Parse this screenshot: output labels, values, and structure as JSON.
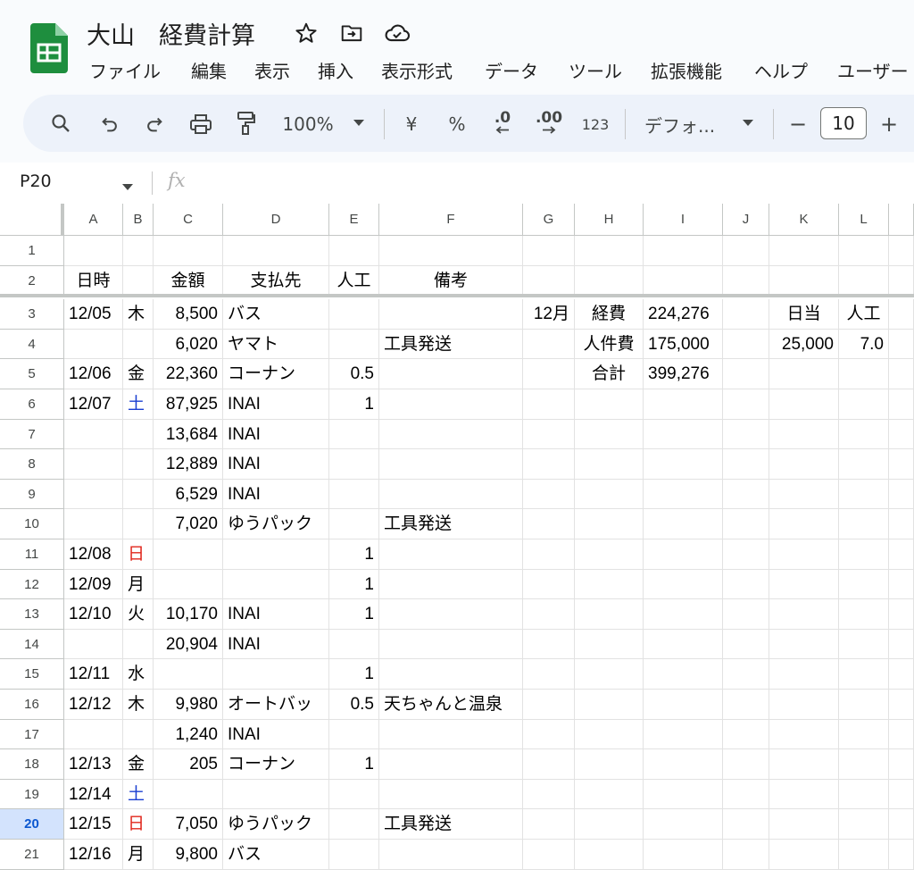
{
  "title": {
    "text": "大山　経費計算",
    "icons": [
      "star-icon",
      "move-folder-icon",
      "cloud-status-icon"
    ]
  },
  "menu": [
    "ファイル",
    "編集",
    "表示",
    "挿入",
    "表示形式",
    "データ",
    "ツール",
    "拡張機能",
    "ヘルプ",
    "ユーザー"
  ],
  "toolbar": {
    "zoom": "100%",
    "currency": "¥",
    "percent": "%",
    "dec_decrease": ".0",
    "dec_increase": ".00",
    "number_format": "123",
    "font": "デフォ...",
    "font_size_minus": "−",
    "font_size": "10",
    "font_size_plus": "+"
  },
  "formula_bar": {
    "name_box": "P20",
    "fx": "fx",
    "value": ""
  },
  "selected_row": "20",
  "columns": [
    "A",
    "B",
    "C",
    "D",
    "E",
    "F",
    "G",
    "H",
    "I",
    "J",
    "K",
    "L"
  ],
  "rows": [
    {
      "num": "1",
      "A": "",
      "B": "",
      "C": "",
      "D": "",
      "E": "",
      "F": "",
      "G": "",
      "H": "",
      "I": "",
      "J": "",
      "K": "",
      "L": ""
    },
    {
      "num": "2",
      "A": "日時",
      "B": "",
      "C": "金額",
      "D": "支払先",
      "E": "人工",
      "F": "備考",
      "G": "",
      "H": "",
      "I": "",
      "J": "",
      "K": "",
      "L": ""
    },
    {
      "num": "3",
      "A": "12/05",
      "B": "木",
      "C": "8,500",
      "D": "バス",
      "E": "",
      "F": "",
      "G": "12月",
      "H": "経費",
      "I": "224,276",
      "J": "",
      "K": "日当",
      "L": "人工"
    },
    {
      "num": "4",
      "A": "",
      "B": "",
      "C": "6,020",
      "D": "ヤマト",
      "E": "",
      "F": "工具発送",
      "G": "",
      "H": "人件費",
      "I": "175,000",
      "J": "",
      "K": "25,000",
      "L": "7.0"
    },
    {
      "num": "5",
      "A": "12/06",
      "B": "金",
      "C": "22,360",
      "D": "コーナン",
      "E": "0.5",
      "F": "",
      "G": "",
      "H": "合計",
      "I": "399,276",
      "J": "",
      "K": "",
      "L": ""
    },
    {
      "num": "6",
      "A": "12/07",
      "B": "土",
      "C": "87,925",
      "D": "INAI",
      "E": "1",
      "F": "",
      "G": "",
      "H": "",
      "I": "",
      "J": "",
      "K": "",
      "L": ""
    },
    {
      "num": "7",
      "A": "",
      "B": "",
      "C": "13,684",
      "D": "INAI",
      "E": "",
      "F": "",
      "G": "",
      "H": "",
      "I": "",
      "J": "",
      "K": "",
      "L": ""
    },
    {
      "num": "8",
      "A": "",
      "B": "",
      "C": "12,889",
      "D": "INAI",
      "E": "",
      "F": "",
      "G": "",
      "H": "",
      "I": "",
      "J": "",
      "K": "",
      "L": ""
    },
    {
      "num": "9",
      "A": "",
      "B": "",
      "C": "6,529",
      "D": "INAI",
      "E": "",
      "F": "",
      "G": "",
      "H": "",
      "I": "",
      "J": "",
      "K": "",
      "L": ""
    },
    {
      "num": "10",
      "A": "",
      "B": "",
      "C": "7,020",
      "D": "ゆうパック",
      "E": "",
      "F": "工具発送",
      "G": "",
      "H": "",
      "I": "",
      "J": "",
      "K": "",
      "L": ""
    },
    {
      "num": "11",
      "A": "12/08",
      "B": "日",
      "C": "",
      "D": "",
      "E": "1",
      "F": "",
      "G": "",
      "H": "",
      "I": "",
      "J": "",
      "K": "",
      "L": ""
    },
    {
      "num": "12",
      "A": "12/09",
      "B": "月",
      "C": "",
      "D": "",
      "E": "1",
      "F": "",
      "G": "",
      "H": "",
      "I": "",
      "J": "",
      "K": "",
      "L": ""
    },
    {
      "num": "13",
      "A": "12/10",
      "B": "火",
      "C": "10,170",
      "D": "INAI",
      "E": "1",
      "F": "",
      "G": "",
      "H": "",
      "I": "",
      "J": "",
      "K": "",
      "L": ""
    },
    {
      "num": "14",
      "A": "",
      "B": "",
      "C": "20,904",
      "D": "INAI",
      "E": "",
      "F": "",
      "G": "",
      "H": "",
      "I": "",
      "J": "",
      "K": "",
      "L": ""
    },
    {
      "num": "15",
      "A": "12/11",
      "B": "水",
      "C": "",
      "D": "",
      "E": "1",
      "F": "",
      "G": "",
      "H": "",
      "I": "",
      "J": "",
      "K": "",
      "L": ""
    },
    {
      "num": "16",
      "A": "12/12",
      "B": "木",
      "C": "9,980",
      "D": "オートバッ",
      "E": "0.5",
      "F": "天ちゃんと温泉",
      "G": "",
      "H": "",
      "I": "",
      "J": "",
      "K": "",
      "L": ""
    },
    {
      "num": "17",
      "A": "",
      "B": "",
      "C": "1,240",
      "D": "INAI",
      "E": "",
      "F": "",
      "G": "",
      "H": "",
      "I": "",
      "J": "",
      "K": "",
      "L": ""
    },
    {
      "num": "18",
      "A": "12/13",
      "B": "金",
      "C": "205",
      "D": "コーナン",
      "E": "1",
      "F": "",
      "G": "",
      "H": "",
      "I": "",
      "J": "",
      "K": "",
      "L": ""
    },
    {
      "num": "19",
      "A": "12/14",
      "B": "土",
      "C": "",
      "D": "",
      "E": "",
      "F": "",
      "G": "",
      "H": "",
      "I": "",
      "J": "",
      "K": "",
      "L": ""
    },
    {
      "num": "20",
      "A": "12/15",
      "B": "日",
      "C": "7,050",
      "D": "ゆうパック",
      "E": "",
      "F": "工具発送",
      "G": "",
      "H": "",
      "I": "",
      "J": "",
      "K": "",
      "L": ""
    },
    {
      "num": "21",
      "A": "12/16",
      "B": "月",
      "C": "9,800",
      "D": "バス",
      "E": "",
      "F": "",
      "G": "",
      "H": "",
      "I": "",
      "J": "",
      "K": "",
      "L": ""
    }
  ],
  "colors": {
    "sunday": "#e0261b",
    "saturday": "#1a3fd1",
    "selected_header": "#d3e3fd",
    "toolbar_bg": "#edf2fa",
    "sheets_green": "#1e8e3e"
  }
}
